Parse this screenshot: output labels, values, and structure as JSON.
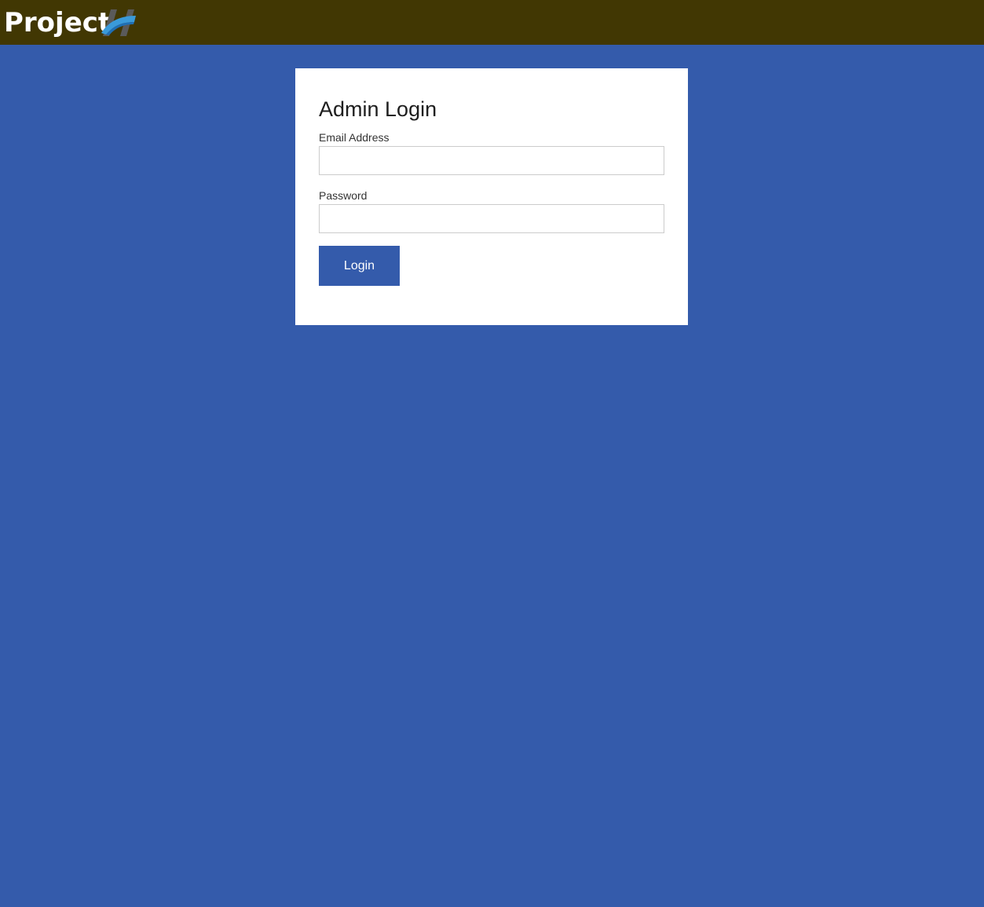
{
  "header": {
    "logo_text": "Project",
    "logo_mark": "H",
    "background": "#413703"
  },
  "page": {
    "background": "#345BAB"
  },
  "login_form": {
    "title": "Admin Login",
    "email": {
      "label": "Email Address",
      "value": "",
      "placeholder": ""
    },
    "password": {
      "label": "Password",
      "value": "",
      "placeholder": ""
    },
    "submit_label": "Login",
    "accent": "#345BAB"
  }
}
